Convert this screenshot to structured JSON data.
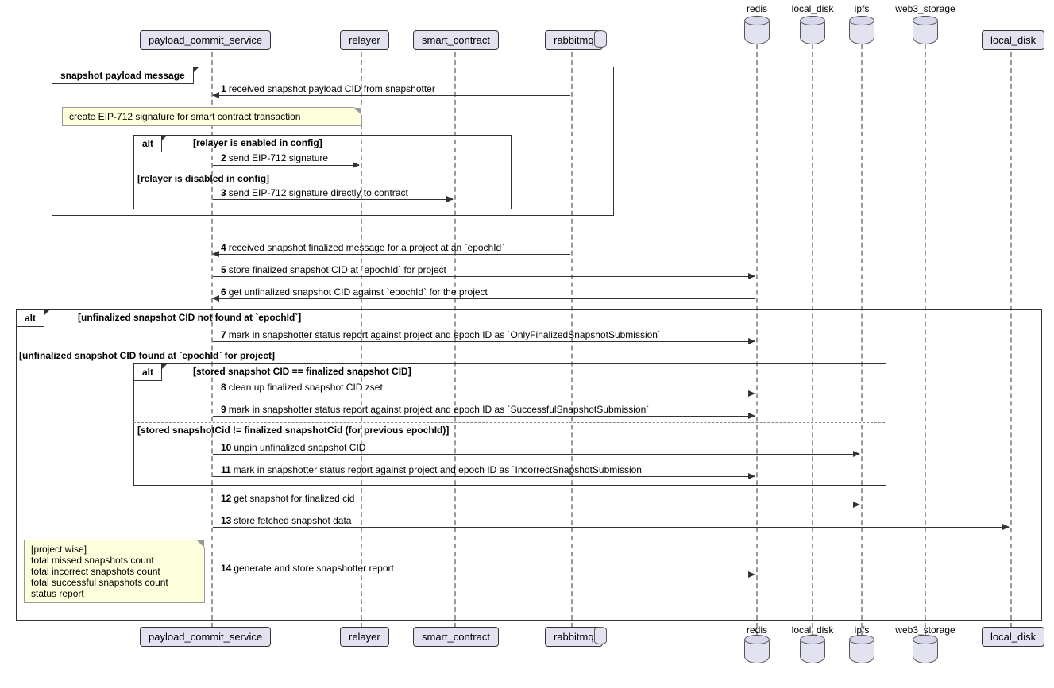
{
  "participants": {
    "payload_commit_service": "payload_commit_service",
    "relayer": "relayer",
    "smart_contract": "smart_contract",
    "rabbitmq": "rabbitmq",
    "redis": "redis",
    "local_disk": "local_disk",
    "ipfs": "ipfs",
    "web3_storage": "web3_storage",
    "local_disk2": "local_disk"
  },
  "frag1": {
    "title": "snapshot payload message",
    "note": "create EIP-712 signature for smart contract transaction",
    "alt_label": "alt",
    "alt_g1": "[relayer is enabled in config]",
    "alt_g2": "[relayer is disabled in config]"
  },
  "frag2": {
    "alt_label": "alt",
    "g1": "[unfinalized snapshot CID not found at `epochId`]",
    "g2": "[unfinalized snapshot CID found at `epochId` for project]",
    "inner_alt_label": "alt",
    "inner_g1": "[stored snapshot CID == finalized snapshot CID]",
    "inner_g2": "[stored snapshotCid != finalized snapshotCid (for previous epochId)]"
  },
  "note2": "[project wise]\ntotal missed snapshots count\ntotal incorrect snapshots count\ntotal successful snapshots count\nstatus report",
  "m": {
    "1": "received snapshot payload CID from snapshotter",
    "2": "send EIP-712 signature",
    "3": "send EIP-712 signature directly to contract",
    "4": "received snapshot finalized message for a project at an `epochId`",
    "5": "store finalized snapshot CID at `epochId` for project",
    "6": "get unfinalized snapshot CID against `epochId` for the project",
    "7": "mark in snapshotter status report against project and epoch ID as `OnlyFinalizedSnapshotSubmission`",
    "8": "clean up finalized snapshot CID zset",
    "9": "mark in snapshotter status report against project and epoch ID as `SuccessfulSnapshotSubmission`",
    "10": "unpin unfinalized snapshot CID",
    "11": "mark in snapshotter status report against project and epoch ID as `IncorrectSnapshotSubmission`",
    "12": "get snapshot for finalized cid",
    "13": "store fetched snapshot data",
    "14": "generate and store snapshotter report"
  },
  "nums": {
    "1": "1",
    "2": "2",
    "3": "3",
    "4": "4",
    "5": "5",
    "6": "6",
    "7": "7",
    "8": "8",
    "9": "9",
    "10": "10",
    "11": "11",
    "12": "12",
    "13": "13",
    "14": "14"
  }
}
